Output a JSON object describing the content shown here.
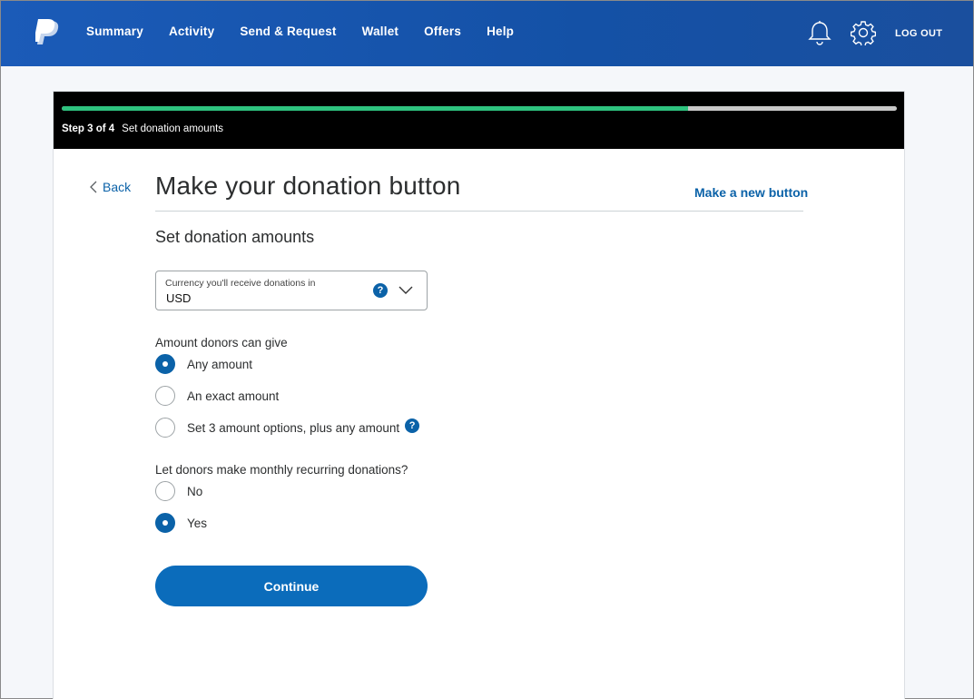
{
  "header": {
    "nav": [
      "Summary",
      "Activity",
      "Send & Request",
      "Wallet",
      "Offers",
      "Help"
    ],
    "logout_label": "LOG OUT",
    "icons": [
      "paypal-logo",
      "bell-icon",
      "gear-icon"
    ]
  },
  "progress": {
    "step_text": "Step 3 of 4",
    "step_name": "Set donation amounts",
    "fraction": 0.75,
    "fill_color": "#2ec27e"
  },
  "page": {
    "back_label": "Back",
    "title": "Make your donation button",
    "new_button_label": "Make a new button",
    "subtitle": "Set donation amounts"
  },
  "currency": {
    "label": "Currency you'll receive donations in",
    "value": "USD"
  },
  "amounts": {
    "label": "Amount donors can give",
    "options": [
      {
        "label": "Any amount",
        "selected": true
      },
      {
        "label": "An exact amount",
        "selected": false
      },
      {
        "label": "Set 3 amount options, plus any amount",
        "selected": false
      }
    ]
  },
  "recurring": {
    "label": "Let donors make monthly recurring donations?",
    "options": [
      {
        "label": "No",
        "selected": false
      },
      {
        "label": "Yes",
        "selected": true
      }
    ]
  },
  "continue_label": "Continue",
  "colors": {
    "header_blue": "#1b5bb8",
    "link_blue": "#0b62a8",
    "button_blue": "#0b6cbb"
  }
}
